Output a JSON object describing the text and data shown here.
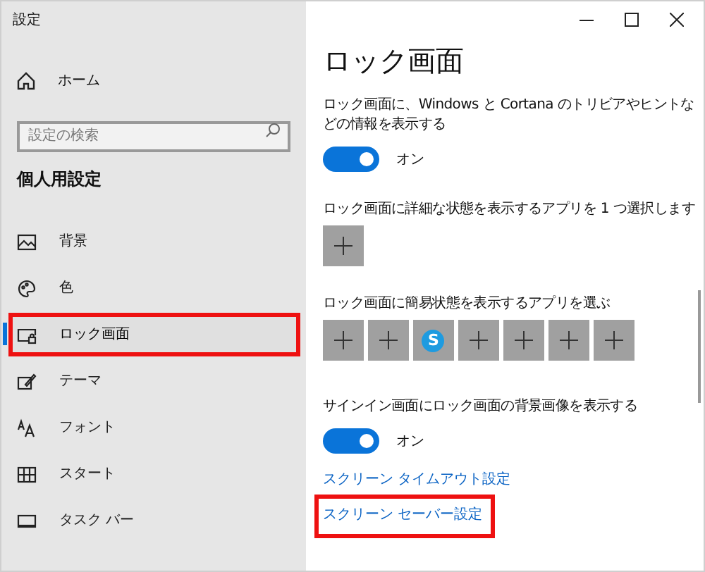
{
  "window": {
    "title": "設定"
  },
  "sidebar": {
    "home": "ホーム",
    "search": {
      "placeholder": "設定の検索"
    },
    "section": "個人用設定",
    "items": [
      {
        "kind": "background",
        "label": "背景",
        "selected": false,
        "highlighted": false
      },
      {
        "kind": "color",
        "label": "色",
        "selected": false,
        "highlighted": false
      },
      {
        "kind": "lock",
        "label": "ロック画面",
        "selected": true,
        "highlighted": true
      },
      {
        "kind": "theme",
        "label": "テーマ",
        "selected": false,
        "highlighted": false
      },
      {
        "kind": "font",
        "label": "フォント",
        "selected": false,
        "highlighted": false
      },
      {
        "kind": "start",
        "label": "スタート",
        "selected": false,
        "highlighted": false
      },
      {
        "kind": "taskbar",
        "label": "タスク バー",
        "selected": false,
        "highlighted": false
      }
    ]
  },
  "page": {
    "title": "ロック画面",
    "sections": [
      {
        "kind": "toggle",
        "label": "ロック画面に、Windows と Cortana のトリビアやヒントなどの情報を表示する",
        "on": true,
        "state": "オン"
      },
      {
        "kind": "tiles",
        "label": "ロック画面に詳細な状態を表示するアプリを 1 つ選択します",
        "tiles": [
          {
            "kind": "add"
          }
        ]
      },
      {
        "kind": "tiles",
        "label": "ロック画面に簡易状態を表示するアプリを選ぶ",
        "tiles": [
          {
            "kind": "add"
          },
          {
            "kind": "add"
          },
          {
            "kind": "app",
            "glyph": "S"
          },
          {
            "kind": "add"
          },
          {
            "kind": "add"
          },
          {
            "kind": "add"
          },
          {
            "kind": "add"
          }
        ]
      },
      {
        "kind": "toggle",
        "label": "サインイン画面にロック画面の背景画像を表示する",
        "on": true,
        "state": "オン"
      }
    ],
    "links": [
      {
        "label": "スクリーン タイムアウト設定",
        "highlighted": false
      },
      {
        "label": "スクリーン セーバー設定",
        "highlighted": true
      }
    ]
  }
}
